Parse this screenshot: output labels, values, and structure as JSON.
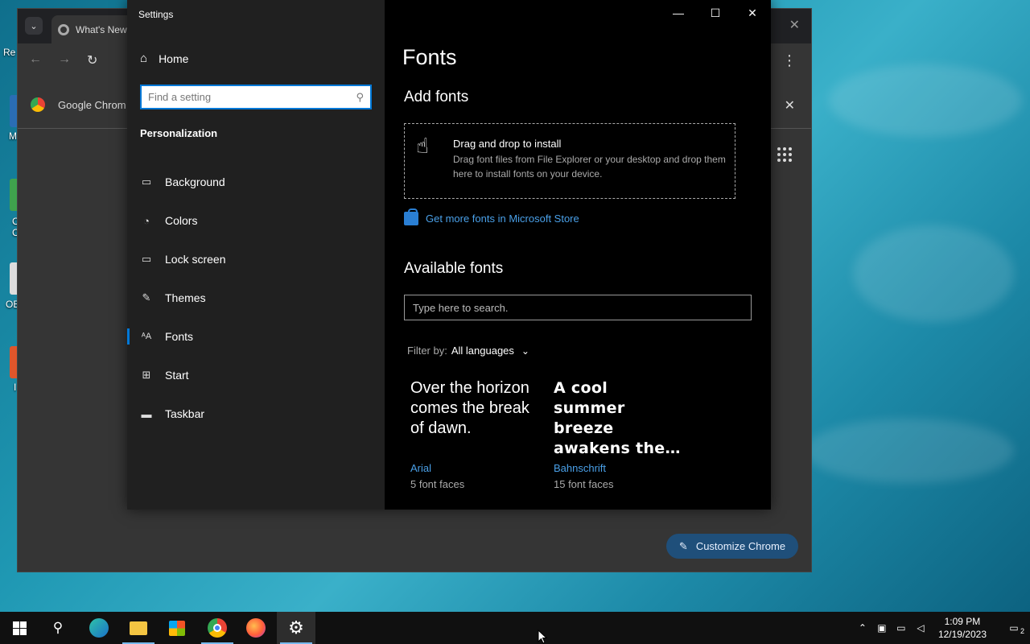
{
  "desktop": {
    "labels": [
      "Re",
      "M",
      "C",
      "C",
      "OB",
      "I"
    ]
  },
  "chrome": {
    "tab_title": "What's New",
    "bookmark_label": "Google Chrom",
    "customize_label": "Customize Chrome"
  },
  "settings": {
    "window_title": "Settings",
    "home_label": "Home",
    "search_placeholder": "Find a setting",
    "section": "Personalization",
    "nav": [
      {
        "label": "Background",
        "icon": "image-icon"
      },
      {
        "label": "Colors",
        "icon": "palette-icon"
      },
      {
        "label": "Lock screen",
        "icon": "lock-screen-icon"
      },
      {
        "label": "Themes",
        "icon": "themes-icon"
      },
      {
        "label": "Fonts",
        "icon": "fonts-icon",
        "active": true
      },
      {
        "label": "Start",
        "icon": "start-icon"
      },
      {
        "label": "Taskbar",
        "icon": "taskbar-icon"
      }
    ],
    "page_title": "Fonts",
    "add_fonts_heading": "Add fonts",
    "drop_title": "Drag and drop to install",
    "drop_desc": "Drag font files from File Explorer or your desktop and drop them here to install fonts on your device.",
    "store_link": "Get more fonts in Microsoft Store",
    "available_heading": "Available fonts",
    "font_search_placeholder": "Type here to search.",
    "filter_label": "Filter by:",
    "filter_value": "All languages",
    "fonts": [
      {
        "sample": "Over the horizon comes the break of dawn.",
        "name": "Arial",
        "faces": "5 font faces"
      },
      {
        "sample": "A cool summer breeze awakens the…",
        "name": "Bahnschrift",
        "faces": "15 font faces"
      }
    ]
  },
  "taskbar": {
    "time": "1:09 PM",
    "date": "12/19/2023",
    "notification_count": "2",
    "apps": [
      "start-icon",
      "search-icon",
      "edge-icon",
      "file-explorer-icon",
      "store-icon",
      "chrome-icon",
      "firefox-icon",
      "settings-icon"
    ]
  },
  "colors": {
    "accent": "#0078d7",
    "link": "#4aa0e8"
  }
}
